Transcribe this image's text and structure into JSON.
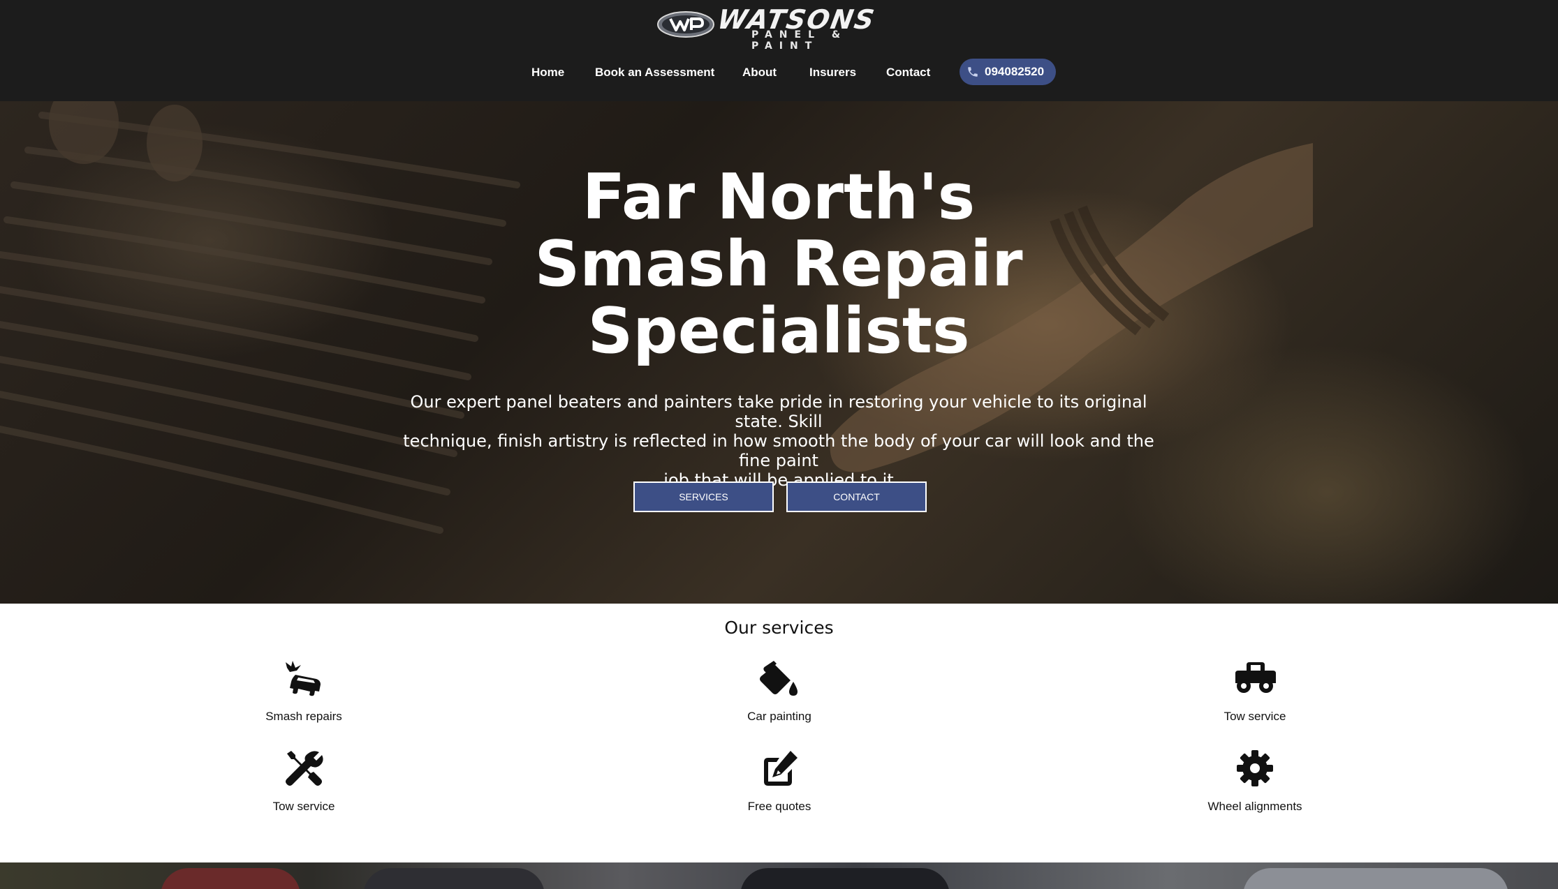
{
  "brand": {
    "name": "WATSONS",
    "tagline": "PANEL & PAINT",
    "badge_icon": "wp-logo-badge"
  },
  "nav": {
    "items": [
      {
        "label": "Home"
      },
      {
        "label": "Book an Assessment"
      },
      {
        "label": "About"
      },
      {
        "label": "Insurers"
      },
      {
        "label": "Contact"
      }
    ],
    "phone": {
      "icon": "phone-icon",
      "number": "094082520"
    }
  },
  "hero": {
    "title_lines": [
      "Far North's",
      "Smash Repair",
      "Specialists"
    ],
    "description_lines": [
      "Our expert panel beaters and painters take pride in restoring your vehicle to its original state. Skill",
      "technique, finish artistry is reflected in how smooth the body of your car will look and the fine paint",
      "job that will be applied to it"
    ],
    "buttons": [
      {
        "label": "SERVICES"
      },
      {
        "label": "CONTACT"
      }
    ]
  },
  "services": {
    "title": "Our services",
    "items": [
      {
        "label": "Smash repairs",
        "icon": "car-crash-icon"
      },
      {
        "label": "Car painting",
        "icon": "paint-bucket-icon"
      },
      {
        "label": "Tow service",
        "icon": "truck-icon"
      },
      {
        "label": "Tow service",
        "icon": "tools-icon"
      },
      {
        "label": "Free quotes",
        "icon": "edit-icon"
      },
      {
        "label": "Wheel alignments",
        "icon": "gear-icon"
      }
    ]
  },
  "colors": {
    "header_bg": "#1c1c1c",
    "accent": "#3d4f86",
    "text_light": "#ffffff",
    "text_dark": "#111111"
  }
}
